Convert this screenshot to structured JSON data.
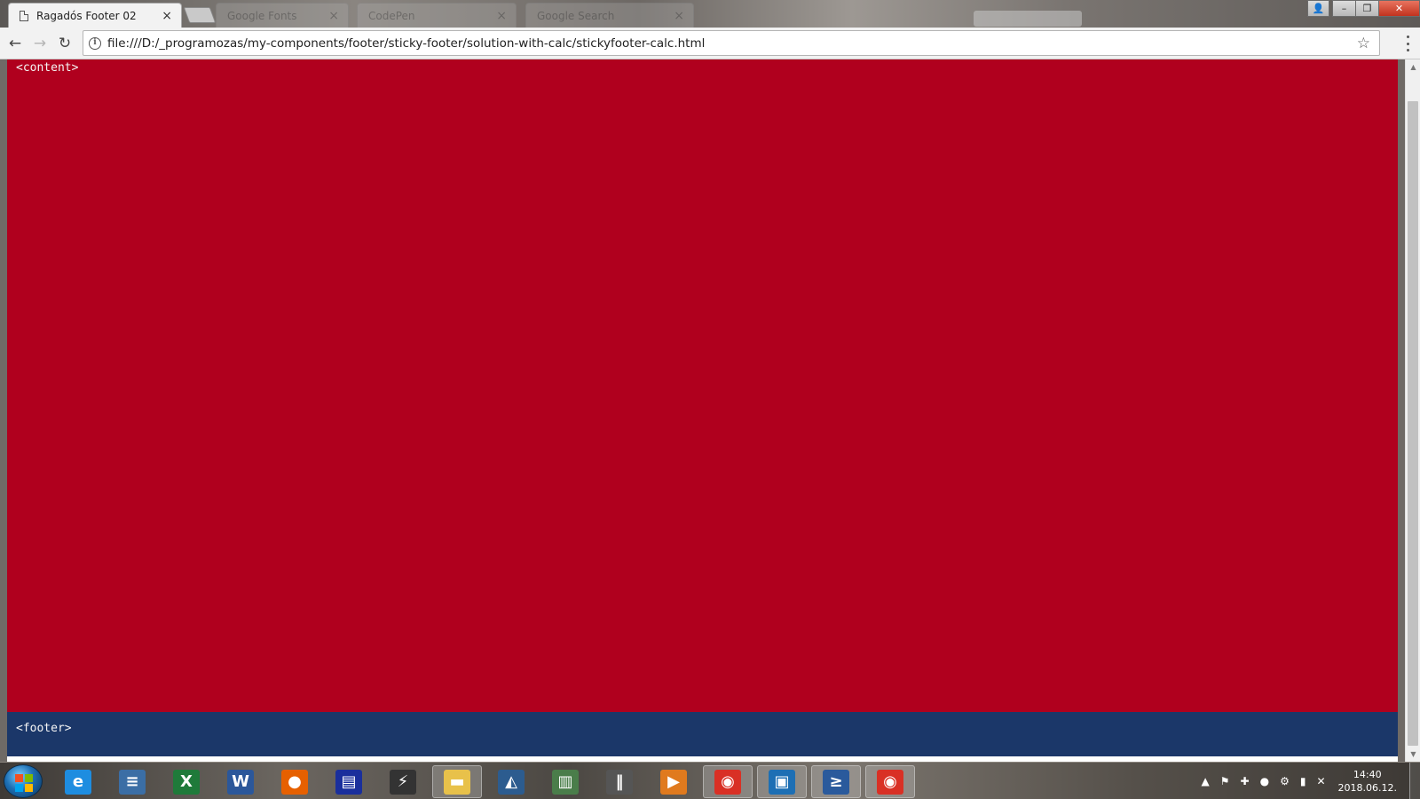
{
  "browser": {
    "active_tab": {
      "title": "Ragadós Footer 02",
      "close": "×"
    },
    "inactive_tabs": [
      {
        "title": "Google Fonts",
        "close": "×"
      },
      {
        "title": "CodePen",
        "close": "×"
      },
      {
        "title": "Google Search",
        "close": "×"
      }
    ],
    "url": "file:///D:/_programozas/my-components/footer/sticky-footer/solution-with-calc/stickyfooter-calc.html",
    "nav": {
      "back": "←",
      "forward": "→",
      "reload": "↻"
    },
    "info_icon": "i",
    "star_icon": "☆",
    "window_controls": {
      "user": "👤",
      "minimize": "–",
      "restore": "❐",
      "close": "✕"
    }
  },
  "page": {
    "content_label": "<content>",
    "footer_label": "<footer>",
    "colors": {
      "content": "#b0001e",
      "footer": "#1b3769"
    }
  },
  "scrollbar": {
    "up": "▲",
    "down": "▼"
  },
  "taskbar": {
    "apps": [
      {
        "name": "internet-explorer-icon",
        "glyph": "e",
        "color": "#1e8de0",
        "open": false
      },
      {
        "name": "file-manager-icon",
        "glyph": "≡",
        "color": "#3b6ea5",
        "open": false
      },
      {
        "name": "excel-icon",
        "glyph": "X",
        "color": "#1f7a3a",
        "open": false
      },
      {
        "name": "word-icon",
        "glyph": "W",
        "color": "#2b579a",
        "open": false
      },
      {
        "name": "firefox-icon",
        "glyph": "●",
        "color": "#e66000",
        "open": false
      },
      {
        "name": "floppy-save-icon",
        "glyph": "▤",
        "color": "#1a2f9c",
        "open": false
      },
      {
        "name": "lightning-tool-icon",
        "glyph": "⚡",
        "color": "#333333",
        "open": false
      },
      {
        "name": "folder-icon",
        "glyph": "▬",
        "color": "#e8c14a",
        "open": true
      },
      {
        "name": "sailboat-app-icon",
        "glyph": "◭",
        "color": "#2c5c8f",
        "open": false
      },
      {
        "name": "reader-icon",
        "glyph": "▥",
        "color": "#4a7d4a",
        "open": false
      },
      {
        "name": "library-icon",
        "glyph": "‖",
        "color": "#555555",
        "open": false
      },
      {
        "name": "media-player-icon",
        "glyph": "▶",
        "color": "#e07a1e",
        "open": false
      },
      {
        "name": "chrome-icon",
        "glyph": "◉",
        "color": "#d93025",
        "open": true
      },
      {
        "name": "sourcetree-icon",
        "glyph": "▣",
        "color": "#1d6fb4",
        "open": true
      },
      {
        "name": "powershell-icon",
        "glyph": "≥",
        "color": "#2a5a9c",
        "open": true
      },
      {
        "name": "chrome-icon-2",
        "glyph": "◉",
        "color": "#d93025",
        "open": true
      }
    ],
    "tray": {
      "icons": [
        "▲",
        "⚑",
        "✚",
        "●",
        "⚙",
        "▮",
        "✕"
      ],
      "time": "14:40",
      "date": "2018.06.12."
    }
  }
}
